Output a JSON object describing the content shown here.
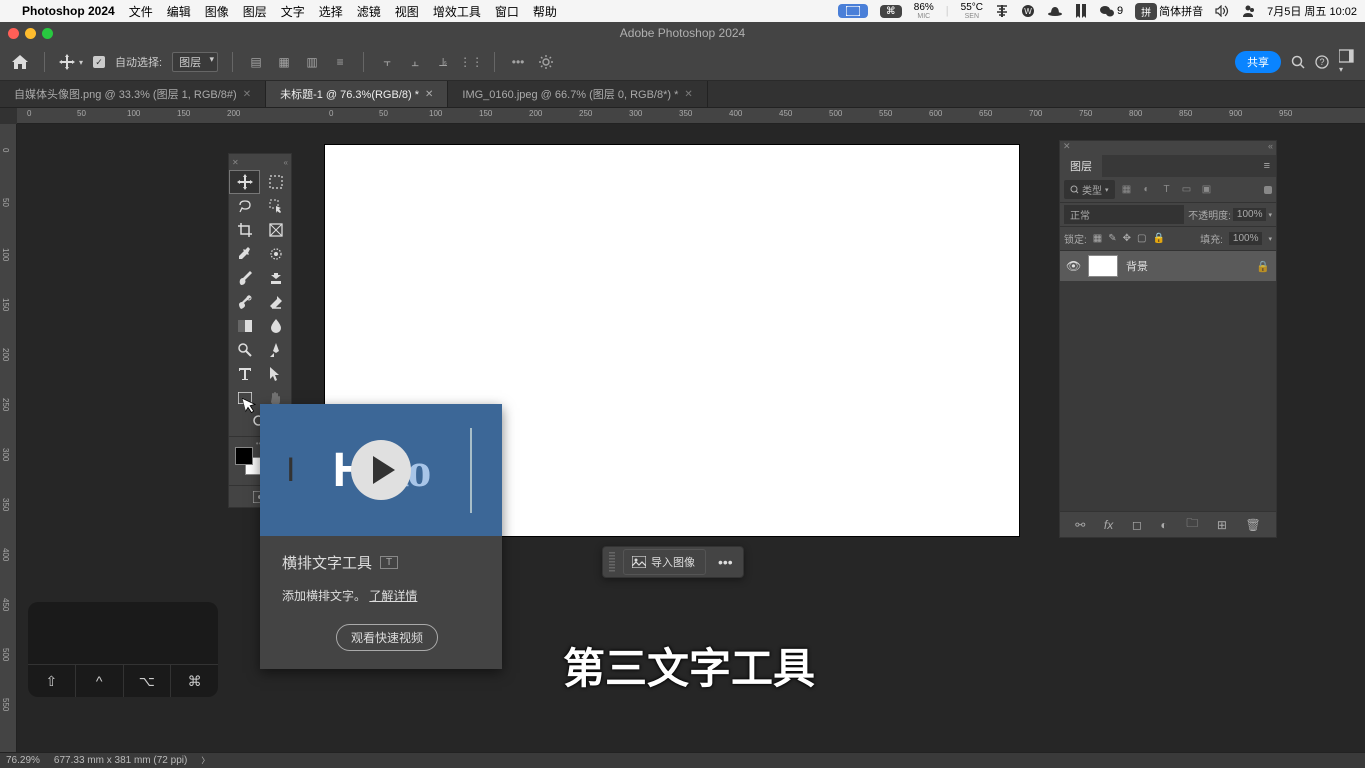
{
  "menubar": {
    "apple": "",
    "appname": "Photoshop 2024",
    "items": [
      "文件",
      "编辑",
      "图像",
      "图层",
      "文字",
      "选择",
      "滤镜",
      "视图",
      "增效工具",
      "窗口",
      "帮助"
    ],
    "right": {
      "battery_pct": "86%",
      "battery_sub": "MIC",
      "temp": "55°C",
      "temp_sub": "SEN",
      "wechat_count": "9",
      "input_method": "简体拼音",
      "input_pill": "拼",
      "datetime": "7月5日 周五 10:02"
    }
  },
  "window_title": "Adobe Photoshop 2024",
  "options_bar": {
    "auto_select_label": "自动选择:",
    "auto_select_target": "图层",
    "share_label": "共享"
  },
  "tabs": [
    {
      "label": "自媒体头像图.png @ 33.3% (图层 1, RGB/8#)",
      "active": false
    },
    {
      "label": "未标题-1 @ 76.3%(RGB/8) *",
      "active": true
    },
    {
      "label": "IMG_0160.jpeg @ 66.7% (图层 0, RGB/8*) *",
      "active": false
    }
  ],
  "ruler_values": [
    "0",
    "50",
    "100",
    "150",
    "200",
    "250",
    "300",
    "350",
    "400",
    "450",
    "500",
    "550",
    "600",
    "650",
    "700",
    "750",
    "800",
    "850",
    "900",
    "950"
  ],
  "ruler_v_values": [
    "0",
    "50",
    "100",
    "150",
    "200",
    "250",
    "300",
    "350",
    "400",
    "450",
    "500",
    "550"
  ],
  "tooltip": {
    "hello": "Hello",
    "title": "横排文字工具",
    "shortcut": "T",
    "desc": "添加横排文字。",
    "learn_more": "了解详情",
    "watch_video": "观看快速视频"
  },
  "context_bar": {
    "import_label": "导入图像",
    "more": "•••"
  },
  "subtitle": "第三文字工具",
  "layers": {
    "panel_title": "图层",
    "filter_label": "类型",
    "blend_mode": "正常",
    "opacity_label": "不透明度:",
    "opacity_value": "100%",
    "lock_label": "锁定:",
    "fill_label": "填充:",
    "fill_value": "100%",
    "items": [
      {
        "name": "背景",
        "locked": true
      }
    ]
  },
  "status": {
    "zoom": "76.29%",
    "doc_info": "677.33 mm x 381 mm (72 ppi)"
  }
}
